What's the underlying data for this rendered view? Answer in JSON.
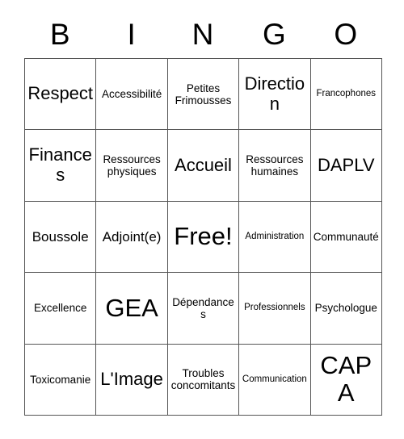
{
  "card": {
    "headers": [
      "B",
      "I",
      "N",
      "G",
      "O"
    ],
    "rows": [
      [
        {
          "label": "Respect",
          "size": "s-lg"
        },
        {
          "label": "Accessibilité",
          "size": "s-sm"
        },
        {
          "label": "Petites Frimousses",
          "size": "s-sm"
        },
        {
          "label": "Direction",
          "size": "s-lg"
        },
        {
          "label": "Francophones",
          "size": "s-xs"
        }
      ],
      [
        {
          "label": "Finances",
          "size": "s-lg"
        },
        {
          "label": "Ressources physiques",
          "size": "s-sm"
        },
        {
          "label": "Accueil",
          "size": "s-lg"
        },
        {
          "label": "Ressources humaines",
          "size": "s-sm"
        },
        {
          "label": "DAPLV",
          "size": "s-lg"
        }
      ],
      [
        {
          "label": "Boussole",
          "size": "s-md"
        },
        {
          "label": "Adjoint(e)",
          "size": "s-md"
        },
        {
          "label": "Free!",
          "size": "s-xl"
        },
        {
          "label": "Administration",
          "size": "s-xs"
        },
        {
          "label": "Communauté",
          "size": "s-sm"
        }
      ],
      [
        {
          "label": "Excellence",
          "size": "s-sm"
        },
        {
          "label": "GEA",
          "size": "s-xl"
        },
        {
          "label": "Dépendances",
          "size": "s-sm"
        },
        {
          "label": "Professionnels",
          "size": "s-xs"
        },
        {
          "label": "Psychologue",
          "size": "s-sm"
        }
      ],
      [
        {
          "label": "Toxicomanie",
          "size": "s-sm"
        },
        {
          "label": "L'Image",
          "size": "s-lg"
        },
        {
          "label": "Troubles concomitants",
          "size": "s-sm"
        },
        {
          "label": "Communication",
          "size": "s-xs"
        },
        {
          "label": "CAPA",
          "size": "s-xl"
        }
      ]
    ]
  }
}
